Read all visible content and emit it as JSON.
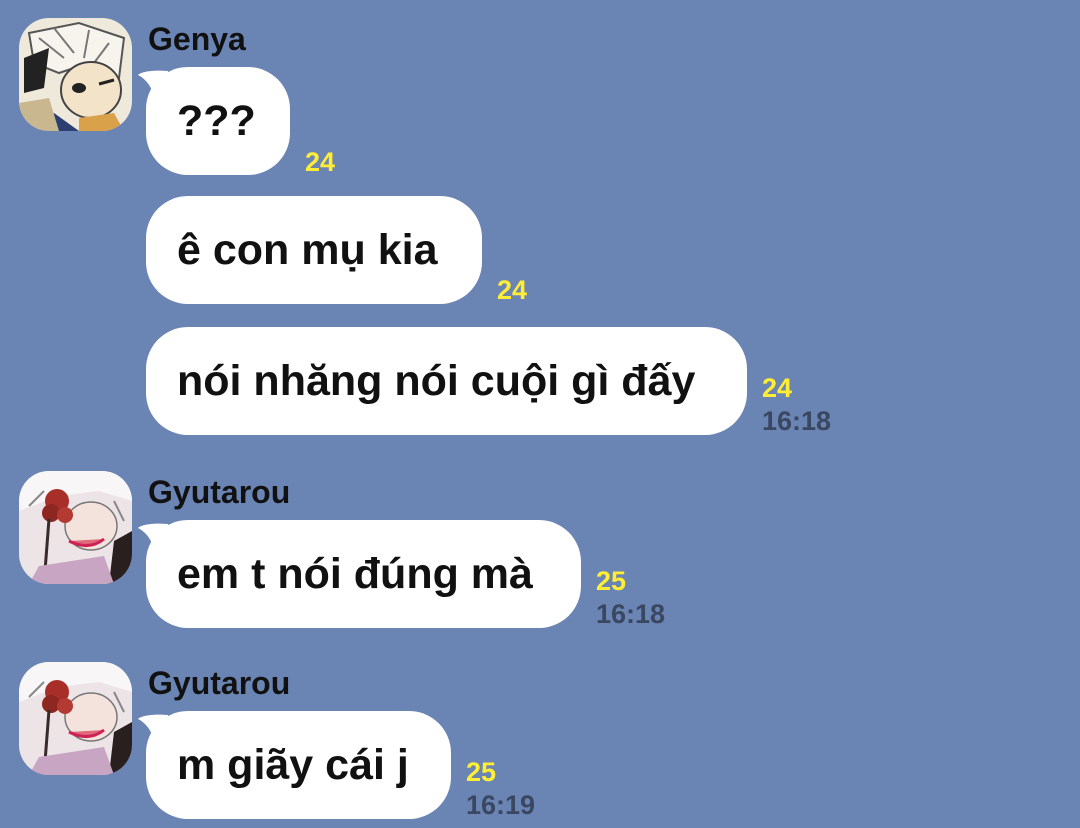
{
  "colors": {
    "background": "#6a84b4",
    "bubble": "#ffffff",
    "read_count": "#ffee33",
    "timestamp": "#3a4761"
  },
  "messages": [
    {
      "sender": "Genya",
      "avatar_icon": "genya-avatar-icon",
      "bubbles": [
        {
          "text": "???",
          "read_count": "24",
          "time": ""
        },
        {
          "text": "ê con mụ kia",
          "read_count": "24",
          "time": ""
        },
        {
          "text": "nói nhăng nói cuội gì đấy",
          "read_count": "24",
          "time": "16:18"
        }
      ]
    },
    {
      "sender": "Gyutarou",
      "avatar_icon": "gyutarou-avatar-icon",
      "bubbles": [
        {
          "text": "em t nói đúng mà",
          "read_count": "25",
          "time": "16:18"
        }
      ]
    },
    {
      "sender": "Gyutarou",
      "avatar_icon": "gyutarou-avatar-icon",
      "bubbles": [
        {
          "text": "m giãy cái j",
          "read_count": "25",
          "time": "16:19"
        }
      ]
    }
  ]
}
